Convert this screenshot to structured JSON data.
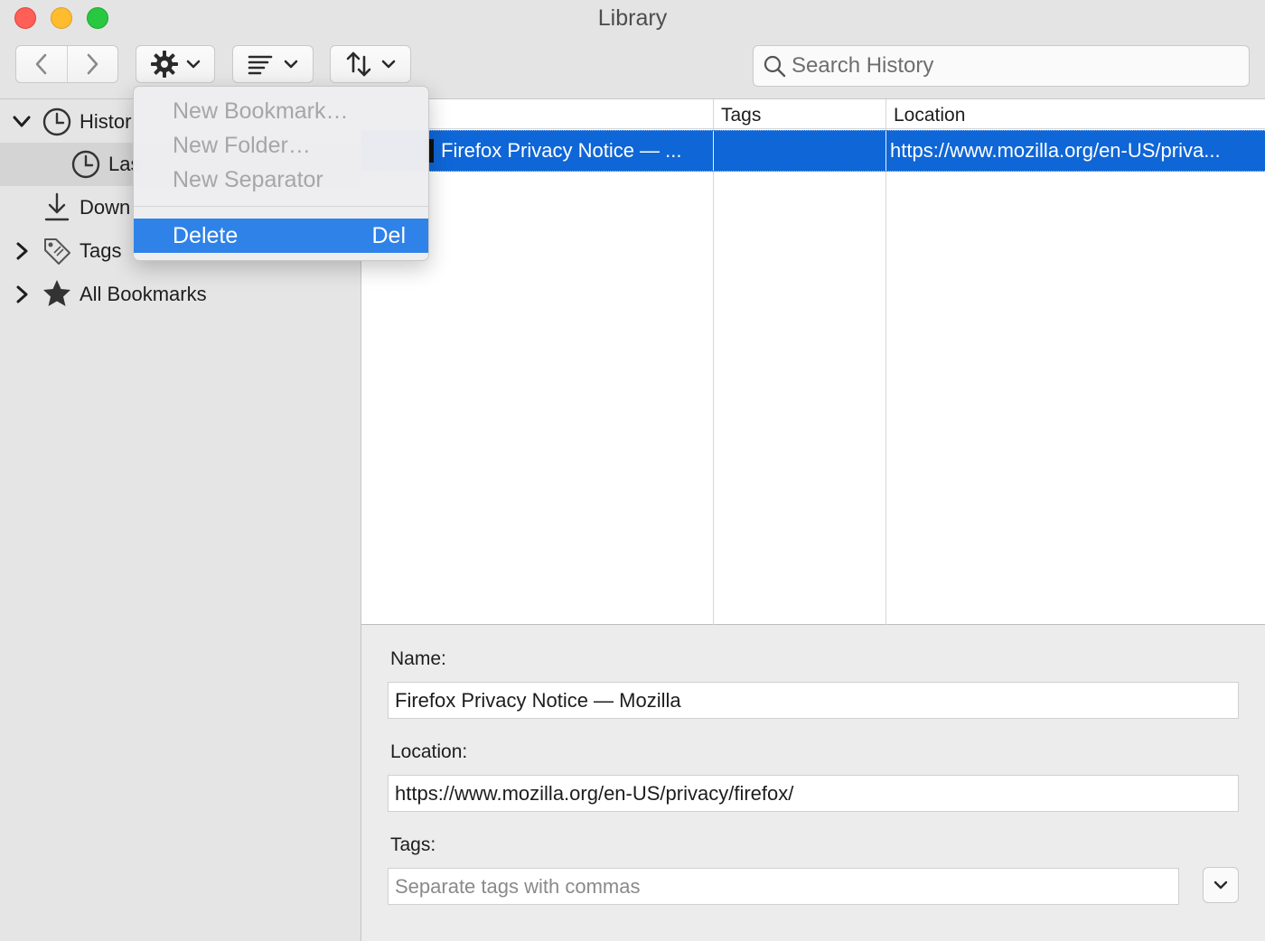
{
  "window": {
    "title": "Library"
  },
  "toolbar": {
    "back_icon": "chevron-left-icon",
    "forward_icon": "chevron-right-icon",
    "organize_icon": "gear-icon",
    "views_icon": "list-icon",
    "sort_icon": "sort-arrows-icon",
    "search_placeholder": "Search History"
  },
  "sidebar": {
    "items": [
      {
        "label": "History",
        "visible_text": "Histor",
        "icon": "clock-icon",
        "expanded": true
      },
      {
        "label": "Last …",
        "visible_text": "Las",
        "icon": "clock-icon",
        "selected": true
      },
      {
        "label": "Downloads",
        "visible_text": "Down",
        "icon": "download-icon"
      },
      {
        "label": "Tags",
        "visible_text": "Tags",
        "icon": "tag-icon",
        "expanded": false
      },
      {
        "label": "All Bookmarks",
        "visible_text": "All Bookmarks",
        "icon": "star-icon",
        "expanded": false
      }
    ]
  },
  "list": {
    "columns": [
      "Tags",
      "Location"
    ],
    "rows": [
      {
        "name": "Firefox Privacy Notice — ...",
        "tags": "",
        "location": "https://www.mozilla.org/en-US/priva..."
      }
    ]
  },
  "details": {
    "name_label": "Name:",
    "name_value": "Firefox Privacy Notice — Mozilla",
    "location_label": "Location:",
    "location_value": "https://www.mozilla.org/en-US/privacy/firefox/",
    "tags_label": "Tags:",
    "tags_placeholder": "Separate tags with commas"
  },
  "menu": {
    "items": [
      {
        "label": "New Bookmark…",
        "enabled": false
      },
      {
        "label": "New Folder…",
        "enabled": false
      },
      {
        "label": "New Separator",
        "enabled": false
      },
      {
        "label": "Delete",
        "shortcut": "Del",
        "enabled": true,
        "highlighted": true
      }
    ]
  },
  "colors": {
    "selection": "#0f66d6",
    "menu_highlight": "#2f82e8",
    "close": "#fe5f57",
    "minimize": "#febc2e",
    "maximize": "#28c840"
  }
}
